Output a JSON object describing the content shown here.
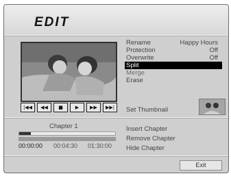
{
  "title": "EDIT",
  "menu": [
    {
      "label": "Rename",
      "value": "Happy Hours",
      "selected": false,
      "dim": false
    },
    {
      "label": "Protection",
      "value": "Off",
      "selected": false,
      "dim": false
    },
    {
      "label": "Overwrite",
      "value": "Off",
      "selected": false,
      "dim": false
    },
    {
      "label": "Split",
      "value": "",
      "selected": true,
      "dim": false
    },
    {
      "label": "Merge",
      "value": "",
      "selected": false,
      "dim": true
    },
    {
      "label": "Erase",
      "value": "",
      "selected": false,
      "dim": false
    }
  ],
  "set_thumbnail": "Set Thumbnail",
  "transport": [
    {
      "icon": "skip-back-icon",
      "glyph": "|◀◀"
    },
    {
      "icon": "rewind-icon",
      "glyph": "◀◀"
    },
    {
      "icon": "stop-icon",
      "glyph": "■"
    },
    {
      "icon": "play-icon",
      "glyph": "▶"
    },
    {
      "icon": "fast-forward-icon",
      "glyph": "▶▶"
    },
    {
      "icon": "skip-forward-icon",
      "glyph": "▶▶|"
    }
  ],
  "chapter": {
    "label": "Chapter 1",
    "progress": 0.12,
    "times": [
      "00:00:00",
      "00:04:30",
      "01:30:00"
    ]
  },
  "chapter_menu": [
    "Insert Chapter",
    "Remove Chapter",
    "Hide Chapter"
  ],
  "exit_label": "Exit"
}
